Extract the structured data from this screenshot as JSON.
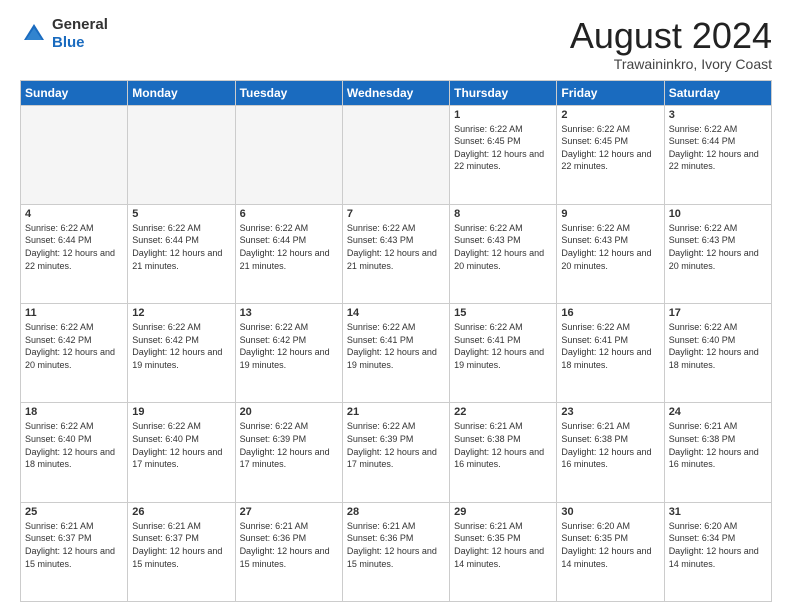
{
  "logo": {
    "general": "General",
    "blue": "Blue"
  },
  "header": {
    "title": "August 2024",
    "subtitle": "Trawaininkro, Ivory Coast"
  },
  "days_of_week": [
    "Sunday",
    "Monday",
    "Tuesday",
    "Wednesday",
    "Thursday",
    "Friday",
    "Saturday"
  ],
  "weeks": [
    [
      {
        "day": "",
        "info": ""
      },
      {
        "day": "",
        "info": ""
      },
      {
        "day": "",
        "info": ""
      },
      {
        "day": "",
        "info": ""
      },
      {
        "day": "1",
        "info": "Sunrise: 6:22 AM\nSunset: 6:45 PM\nDaylight: 12 hours\nand 22 minutes."
      },
      {
        "day": "2",
        "info": "Sunrise: 6:22 AM\nSunset: 6:45 PM\nDaylight: 12 hours\nand 22 minutes."
      },
      {
        "day": "3",
        "info": "Sunrise: 6:22 AM\nSunset: 6:44 PM\nDaylight: 12 hours\nand 22 minutes."
      }
    ],
    [
      {
        "day": "4",
        "info": "Sunrise: 6:22 AM\nSunset: 6:44 PM\nDaylight: 12 hours\nand 22 minutes."
      },
      {
        "day": "5",
        "info": "Sunrise: 6:22 AM\nSunset: 6:44 PM\nDaylight: 12 hours\nand 21 minutes."
      },
      {
        "day": "6",
        "info": "Sunrise: 6:22 AM\nSunset: 6:44 PM\nDaylight: 12 hours\nand 21 minutes."
      },
      {
        "day": "7",
        "info": "Sunrise: 6:22 AM\nSunset: 6:43 PM\nDaylight: 12 hours\nand 21 minutes."
      },
      {
        "day": "8",
        "info": "Sunrise: 6:22 AM\nSunset: 6:43 PM\nDaylight: 12 hours\nand 20 minutes."
      },
      {
        "day": "9",
        "info": "Sunrise: 6:22 AM\nSunset: 6:43 PM\nDaylight: 12 hours\nand 20 minutes."
      },
      {
        "day": "10",
        "info": "Sunrise: 6:22 AM\nSunset: 6:43 PM\nDaylight: 12 hours\nand 20 minutes."
      }
    ],
    [
      {
        "day": "11",
        "info": "Sunrise: 6:22 AM\nSunset: 6:42 PM\nDaylight: 12 hours\nand 20 minutes."
      },
      {
        "day": "12",
        "info": "Sunrise: 6:22 AM\nSunset: 6:42 PM\nDaylight: 12 hours\nand 19 minutes."
      },
      {
        "day": "13",
        "info": "Sunrise: 6:22 AM\nSunset: 6:42 PM\nDaylight: 12 hours\nand 19 minutes."
      },
      {
        "day": "14",
        "info": "Sunrise: 6:22 AM\nSunset: 6:41 PM\nDaylight: 12 hours\nand 19 minutes."
      },
      {
        "day": "15",
        "info": "Sunrise: 6:22 AM\nSunset: 6:41 PM\nDaylight: 12 hours\nand 19 minutes."
      },
      {
        "day": "16",
        "info": "Sunrise: 6:22 AM\nSunset: 6:41 PM\nDaylight: 12 hours\nand 18 minutes."
      },
      {
        "day": "17",
        "info": "Sunrise: 6:22 AM\nSunset: 6:40 PM\nDaylight: 12 hours\nand 18 minutes."
      }
    ],
    [
      {
        "day": "18",
        "info": "Sunrise: 6:22 AM\nSunset: 6:40 PM\nDaylight: 12 hours\nand 18 minutes."
      },
      {
        "day": "19",
        "info": "Sunrise: 6:22 AM\nSunset: 6:40 PM\nDaylight: 12 hours\nand 17 minutes."
      },
      {
        "day": "20",
        "info": "Sunrise: 6:22 AM\nSunset: 6:39 PM\nDaylight: 12 hours\nand 17 minutes."
      },
      {
        "day": "21",
        "info": "Sunrise: 6:22 AM\nSunset: 6:39 PM\nDaylight: 12 hours\nand 17 minutes."
      },
      {
        "day": "22",
        "info": "Sunrise: 6:21 AM\nSunset: 6:38 PM\nDaylight: 12 hours\nand 16 minutes."
      },
      {
        "day": "23",
        "info": "Sunrise: 6:21 AM\nSunset: 6:38 PM\nDaylight: 12 hours\nand 16 minutes."
      },
      {
        "day": "24",
        "info": "Sunrise: 6:21 AM\nSunset: 6:38 PM\nDaylight: 12 hours\nand 16 minutes."
      }
    ],
    [
      {
        "day": "25",
        "info": "Sunrise: 6:21 AM\nSunset: 6:37 PM\nDaylight: 12 hours\nand 15 minutes."
      },
      {
        "day": "26",
        "info": "Sunrise: 6:21 AM\nSunset: 6:37 PM\nDaylight: 12 hours\nand 15 minutes."
      },
      {
        "day": "27",
        "info": "Sunrise: 6:21 AM\nSunset: 6:36 PM\nDaylight: 12 hours\nand 15 minutes."
      },
      {
        "day": "28",
        "info": "Sunrise: 6:21 AM\nSunset: 6:36 PM\nDaylight: 12 hours\nand 15 minutes."
      },
      {
        "day": "29",
        "info": "Sunrise: 6:21 AM\nSunset: 6:35 PM\nDaylight: 12 hours\nand 14 minutes."
      },
      {
        "day": "30",
        "info": "Sunrise: 6:20 AM\nSunset: 6:35 PM\nDaylight: 12 hours\nand 14 minutes."
      },
      {
        "day": "31",
        "info": "Sunrise: 6:20 AM\nSunset: 6:34 PM\nDaylight: 12 hours\nand 14 minutes."
      }
    ]
  ]
}
